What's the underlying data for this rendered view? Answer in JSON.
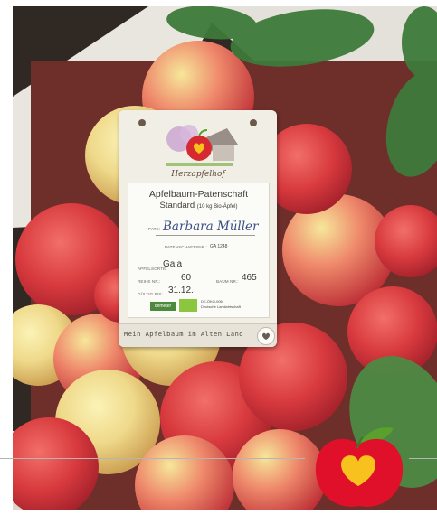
{
  "tag": {
    "logo_text": "Herzapfelhof",
    "title": "Apfelbaum-Patenschaft",
    "subtitle_main": "Standard",
    "subtitle_note": "(10 kg Bio-Äpfel)",
    "pate_label": "PATE:",
    "pate_name": "Barbara Müller",
    "patenschaft_label": "PATENSCHAFTSNR.:",
    "patenschaft_value": "GA 1248",
    "sorte_label": "APFELSORTE:",
    "sorte_value": "Gala",
    "reihe_label": "REIHE NR.:",
    "reihe_value": "60",
    "baum_label": "BAUM NR.:",
    "baum_value": "465",
    "gueltig_label": "GÜLTIG BIS:",
    "gueltig_value": "31.12.",
    "demeter_label": "demeter",
    "eco_code": "DE-ÖKO-006",
    "eco_note": "Deutsche Landwirtschaft",
    "footer": "Mein Apfelbaum im Alten Land"
  },
  "colors": {
    "heart_red": "#e0102a",
    "heart_yellow": "#f7c21e",
    "leaf_green": "#5aa02c",
    "name_blue": "#3b4f86"
  },
  "icons": [
    "apple-logo-icon",
    "heart-icon",
    "apple-heart-badge-icon",
    "leaf-icon"
  ]
}
